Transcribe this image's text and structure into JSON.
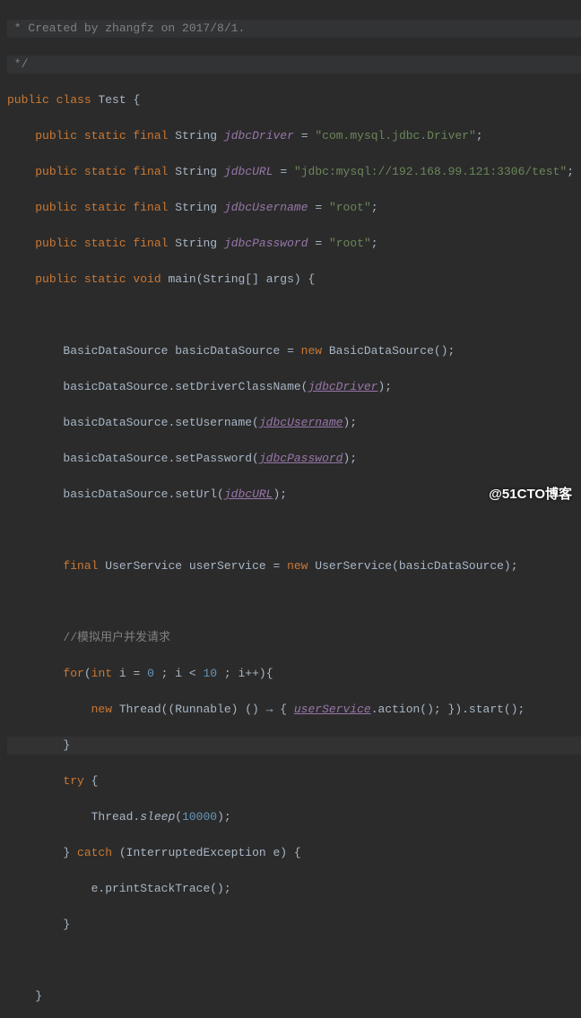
{
  "header_comment": " * Created by zhangfz on 2017/8/1.",
  "header_comment_end": " */",
  "class_decl": {
    "kw_public": "public",
    "kw_class": "class",
    "name": "Test",
    "brace": "{"
  },
  "fields": {
    "driver": {
      "kw": "public static final",
      "type": "String",
      "name": "jdbcDriver",
      "eq": "=",
      "val": "\"com.mysql.jdbc.Driver\"",
      "semi": ";"
    },
    "url": {
      "kw": "public static final",
      "type": "String",
      "name": "jdbcURL",
      "eq": "=",
      "val": "\"jdbc:mysql://192.168.99.121:3306/test\"",
      "semi": ";"
    },
    "user": {
      "kw": "public static final",
      "type": "String",
      "name": "jdbcUsername",
      "eq": "=",
      "val": "\"root\"",
      "semi": ";"
    },
    "pass": {
      "kw": "public static final",
      "type": "String",
      "name": "jdbcPassword",
      "eq": "=",
      "val": "\"root\"",
      "semi": ";"
    }
  },
  "main": {
    "kw": "public static void",
    "name": "main",
    "params": "(String[] args)",
    "brace": "{"
  },
  "body": {
    "l1_a": "BasicDataSource basicDataSource = ",
    "l1_new": "new",
    "l1_b": " BasicDataSource();",
    "l2_a": "basicDataSource.setDriverClassName(",
    "l2_ref": "jdbcDriver",
    "l2_b": ");",
    "l3_a": "basicDataSource.setUsername(",
    "l3_ref": "jdbcUsername",
    "l3_b": ");",
    "l4_a": "basicDataSource.setPassword(",
    "l4_ref": "jdbcPassword",
    "l4_b": ");",
    "l5_a": "basicDataSource.setUrl(",
    "l5_ref": "jdbcURL",
    "l5_b": ");",
    "l6_kw": "final",
    "l6_a": " UserService userService = ",
    "l6_new": "new",
    "l6_b": " UserService(basicDataSource);",
    "comment2": "//模拟用户并发请求",
    "for_kw": "for",
    "for_a": "(",
    "for_int": "int",
    "for_b": " i = ",
    "for_n0": "0",
    "for_c": " ; i < ",
    "for_n1": "10",
    "for_d": " ; i++)",
    "for_brace": "{",
    "thread_new": "new",
    "thread_a": " Thread((Runnable) () → { ",
    "thread_ref": "userService",
    "thread_b": ".action(); }).start();",
    "close_brace": "}",
    "try_kw": "try",
    "try_brace": " {",
    "sleep_a": "Thread.",
    "sleep_m": "sleep",
    "sleep_b": "(",
    "sleep_n": "10000",
    "sleep_c": ");",
    "catch_a": "} ",
    "catch_kw": "catch",
    "catch_b": " (InterruptedException e) {",
    "stack": "e.printStackTrace();",
    "catch_close": "}"
  },
  "method_close": "}",
  "watermark": "@51CTO博客"
}
